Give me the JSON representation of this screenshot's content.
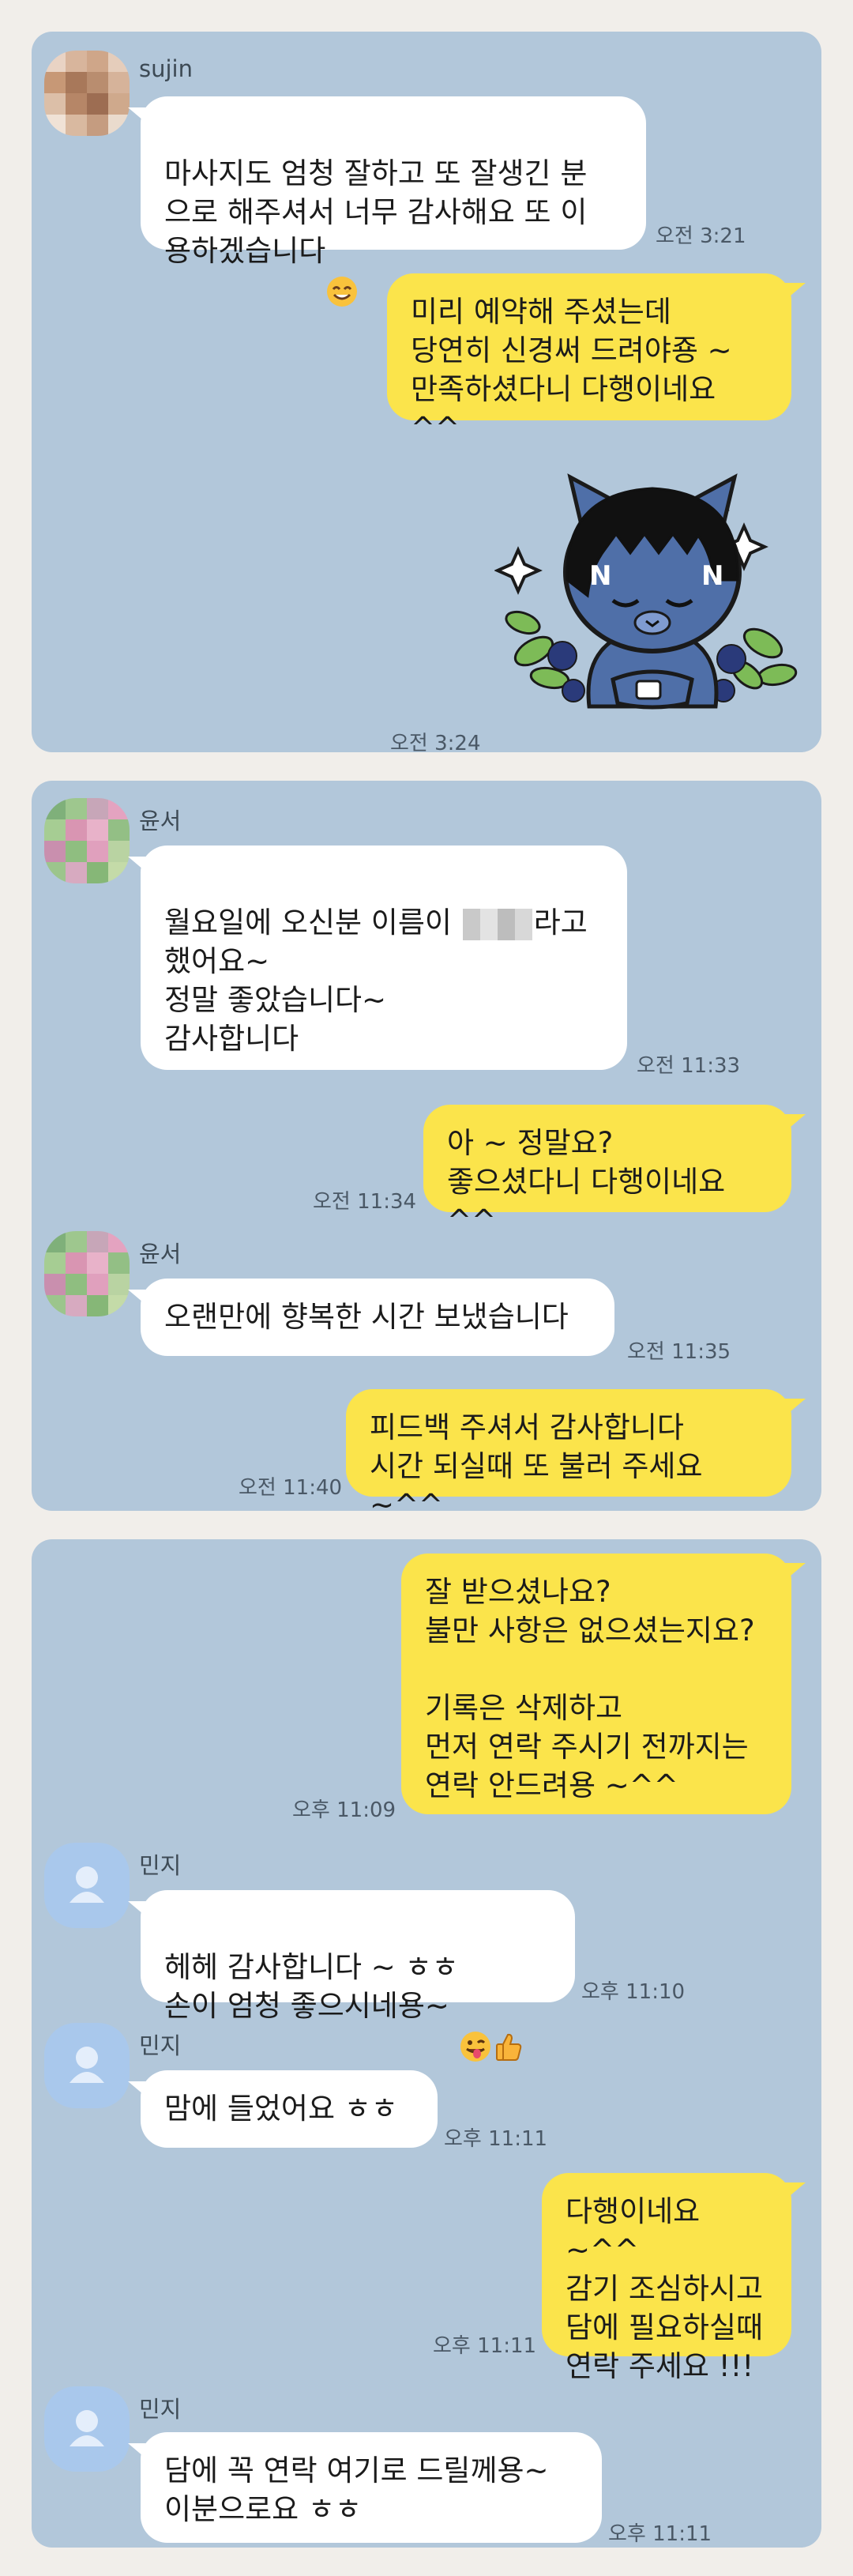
{
  "panel1": {
    "sender": "sujin",
    "in_text": "마사지도 엄청 잘하고 또 잘생긴 분\n으로 해주셔서 너무 감사해요 또 이\n용하겠습니다",
    "in_emoji": "smiling-face-emoji",
    "in_time": "오전 3:21",
    "out_text": "미리 예약해 주셨는데\n당연히 신경써 드려야죵 ~\n만족하셨다니 다행이네요 ^^",
    "sticker": "sleepy-character-sticker",
    "sticker_time": "오전 3:24"
  },
  "panel2": {
    "sender1": "윤서",
    "in1_before": "월요일에 오신분 이름이 ",
    "in1_after": "라고\n했어요~\n정말 좋았습니다~\n감사합니다",
    "in1_time": "오전 11:33",
    "out1_text": "아 ~ 정말요?\n좋으셨다니 다행이네요 ^^",
    "out1_time": "오전 11:34",
    "sender2": "윤서",
    "in2_text": "오랜만에 향복한 시간 보냈습니다",
    "in2_time": "오전 11:35",
    "out2_text": "피드백 주셔서 감사합니다\n시간 되실때 또 불러 주세요 ~^^",
    "out2_time": "오전 11:40"
  },
  "panel3": {
    "out1_text": "잘 받으셨나요?\n불만 사항은 없으셨는지요?\n\n기록은 삭제하고\n먼저 연락 주시기 전까지는\n연락 안드려용 ~^^",
    "out1_time": "오후 11:09",
    "sender1": "민지",
    "in1_text": "헤헤 감사합니다 ~ ㅎㅎ\n손이 엄청 좋으시네용~",
    "in1_emojis": [
      "winking-tongue-emoji",
      "thumbs-up-emoji"
    ],
    "in1_time": "오후 11:10",
    "sender2": "민지",
    "in2_text": "맘에 들었어요 ㅎㅎ",
    "in2_time": "오후 11:11",
    "out2_text": "다행이네요 ~^^\n감기 조심하시고\n담에 필요하실때\n연락 주세요 !!!",
    "out2_time": "오후 11:11",
    "sender3": "민지",
    "in3_text": "담에 꼭 연락 여기로 드릴께용~\n이분으로요 ㅎㅎ",
    "in3_time": "오후 11:11"
  },
  "colors": {
    "chat_bg": "#b2c7da",
    "outgoing_bubble": "#fbe44b",
    "incoming_bubble": "#ffffff",
    "page_bg": "#f1eeea"
  }
}
